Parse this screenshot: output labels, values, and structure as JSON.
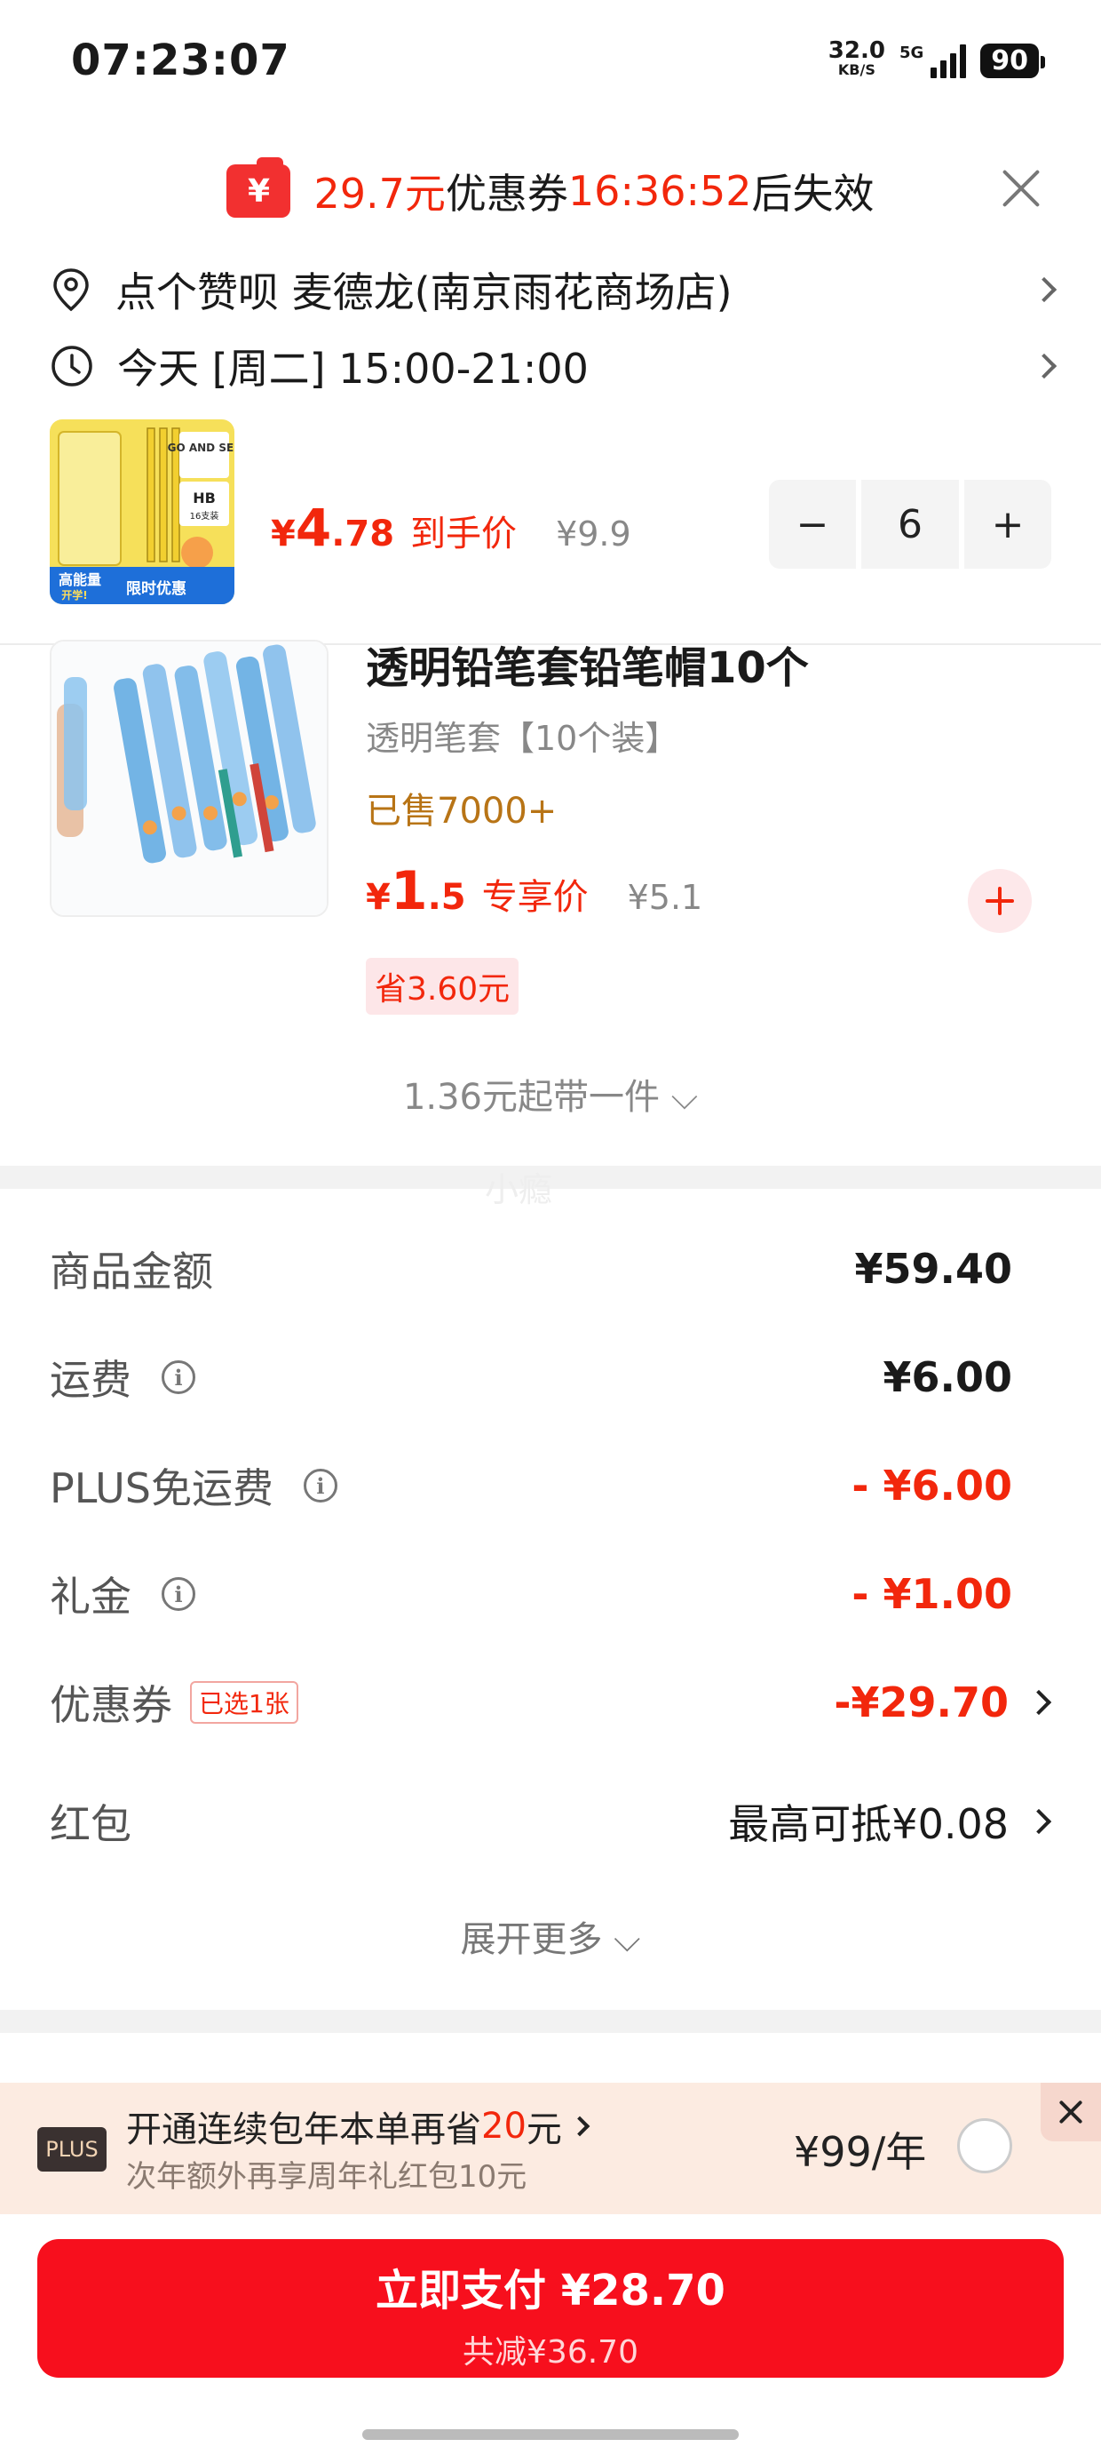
{
  "status_bar": {
    "time": "07:23:07",
    "net_speed": "32.0",
    "net_speed_unit": "KB/S",
    "network": "5G",
    "battery": "90"
  },
  "coupon_banner": {
    "amount": "29.7元",
    "label": "优惠券",
    "countdown": "16:36:52",
    "suffix": "后失效"
  },
  "delivery": {
    "address": "点个赞呗  麦德龙(南京雨花商场店)",
    "time": "今天 [周二] 15:00-21:00"
  },
  "main_product": {
    "price_symbol": "¥",
    "price_int": "4",
    "price_dec": ".78",
    "price_tag": "到手价",
    "old_price": "¥9.9",
    "quantity": "6",
    "minus": "−",
    "plus": "+",
    "thumb_text": {
      "hb": "HB",
      "pack": "16支装",
      "go": "GO AND SEE",
      "promo1": "高能量",
      "promo2": "开学!",
      "promo3": "限时优惠"
    }
  },
  "addon_product": {
    "title": "透明铅笔套铅笔帽10个",
    "subtitle": "透明笔套【10个装】",
    "sold": "已售7000+",
    "price_symbol": "¥",
    "price_int": "1",
    "price_dec": ".5",
    "price_tag": "专享价",
    "old_price": "¥5.1",
    "save_badge": "省3.60元",
    "more_link": "1.36元起带一件 ⌵"
  },
  "watermark": "小瘾",
  "fees": {
    "goods_label": "商品金额",
    "goods_value": "¥59.40",
    "shipping_label": "运费",
    "shipping_value": "¥6.00",
    "plus_free_label": "PLUS免运费",
    "plus_free_value": "- ¥6.00",
    "gift_label": "礼金",
    "gift_value": "- ¥1.00",
    "coupon_label": "优惠券",
    "coupon_tag": "已选1张",
    "coupon_value": "-¥29.70",
    "redpacket_label": "红包",
    "redpacket_value": "最高可抵¥0.08",
    "expand_more": "展开更多 ⌵"
  },
  "plus_bar": {
    "logo": "PLUS",
    "main_prefix": "开通连续包年本单再省",
    "main_amount": "20",
    "main_suffix": "元",
    "sub": "次年额外再享周年礼红包10元",
    "price": "¥99/年"
  },
  "pay": {
    "main": "立即支付 ¥28.70",
    "sub": "共减¥36.70"
  },
  "colors": {
    "accent_red": "#f2270c",
    "pay_button": "#f70f1d",
    "sold_text": "#b87416",
    "plus_bg": "#fcebe1"
  }
}
